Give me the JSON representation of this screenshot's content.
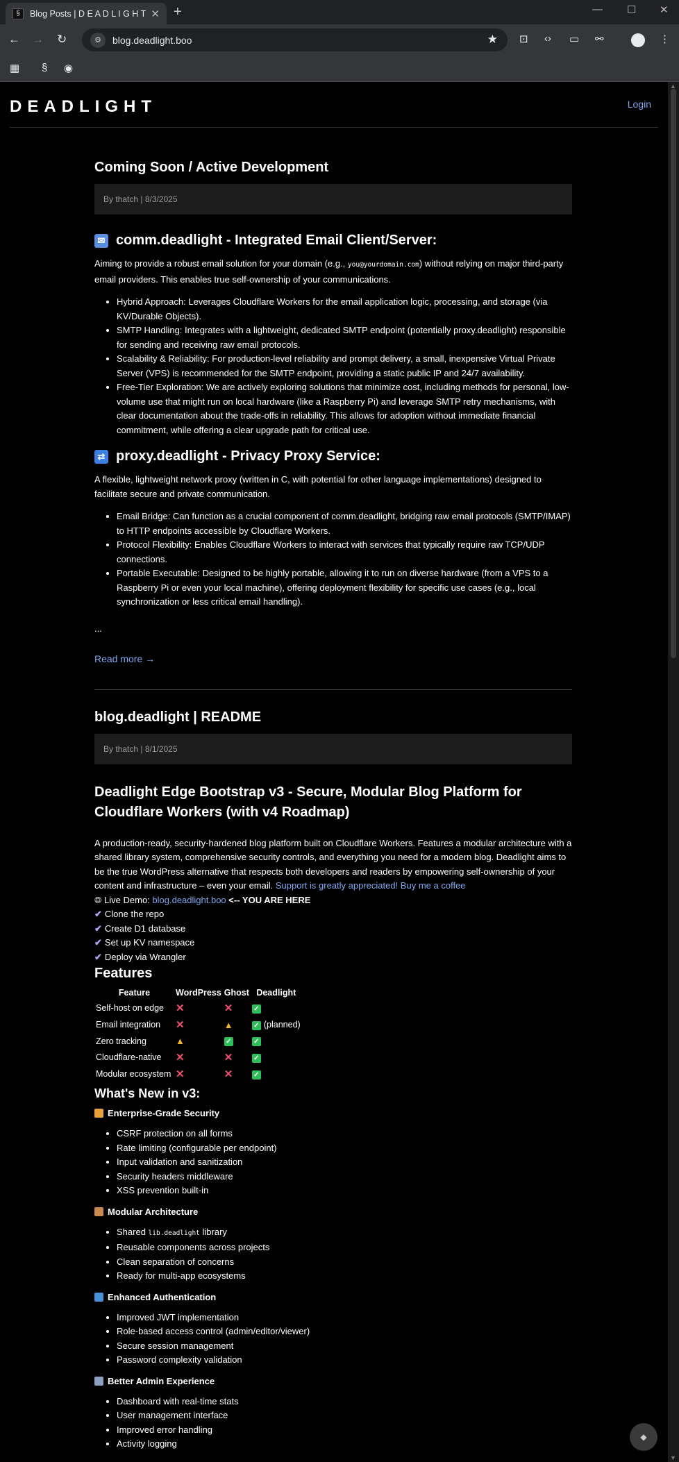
{
  "browser": {
    "tab_title": "Blog Posts | D E A D L I G H T",
    "url": "blog.deadlight.boo",
    "new_tab_label": "+",
    "close_label": "✕"
  },
  "site": {
    "logo": "DEADLIGHT",
    "login": "Login"
  },
  "post1": {
    "title": "Coming Soon / Active Development",
    "meta": "By thatch | 8/3/2025",
    "h1": "comm.deadlight - Integrated Email Client/Server:",
    "p1_a": "Aiming to provide a robust email solution for your domain (e.g., ",
    "p1_code": "you@yourdomain.com",
    "p1_b": ") without relying on major third-party email providers. This enables true self-ownership of your communications.",
    "list1": [
      "Hybrid Approach: Leverages Cloudflare Workers for the email application logic, processing, and storage (via KV/Durable Objects).",
      "SMTP Handling: Integrates with a lightweight, dedicated SMTP endpoint (potentially proxy.deadlight) responsible for sending and receiving raw email protocols.",
      "Scalability & Reliability: For production-level reliability and prompt delivery, a small, inexpensive Virtual Private Server (VPS) is recommended for the SMTP endpoint, providing a static public IP and 24/7 availability.",
      "Free-Tier Exploration: We are actively exploring solutions that minimize cost, including methods for personal, low-volume use that might run on local hardware (like a Raspberry Pi) and leverage SMTP retry mechanisms, with clear documentation about the trade-offs in reliability. This allows for adoption without immediate financial commitment, while offering a clear upgrade path for critical use."
    ],
    "h2": "proxy.deadlight - Privacy Proxy Service:",
    "p2": "A flexible, lightweight network proxy (written in C, with potential for other language implementations) designed to facilitate secure and private communication.",
    "list2": [
      "Email Bridge: Can function as a crucial component of comm.deadlight, bridging raw email protocols (SMTP/IMAP) to HTTP endpoints accessible by Cloudflare Workers.",
      "Protocol Flexibility: Enables Cloudflare Workers to interact with services that typically require raw TCP/UDP connections.",
      "Portable Executable: Designed to be highly portable, allowing it to run on diverse hardware (from a VPS to a Raspberry Pi or even your local machine), offering deployment flexibility for specific use cases (e.g., local synchronization or less critical email handling)."
    ],
    "ellipsis": "...",
    "read_more": "Read more →"
  },
  "post2": {
    "title": "blog.deadlight | README",
    "meta": "By thatch | 8/1/2025",
    "heading": "Deadlight Edge Bootstrap v3 - Secure, Modular Blog Platform for Cloudflare Workers (with v4 Roadmap)",
    "intro": "A production-ready, security-hardened blog platform built on Cloudflare Workers. Features a modular architecture with a shared library system, comprehensive security controls, and everything you need for a modern blog. Deadlight aims to be the true WordPress alternative that respects both developers and readers by empowering self-ownership of your content and infrastructure – even your email. ",
    "support_link": "Support is greatly appreciated! Buy me a coffee",
    "demo_label": "Live Demo: ",
    "demo_link": "blog.deadlight.boo",
    "demo_suffix": " <-- YOU ARE HERE",
    "checks": [
      "Clone the repo",
      "Create D1 database",
      "Set up KV namespace",
      "Deploy via Wrangler"
    ],
    "features_heading": "Features",
    "table_headers": [
      "Feature",
      "WordPress",
      "Ghost",
      "Deadlight"
    ],
    "table_rows": [
      {
        "feature": "Self-host on edge",
        "wp": "x",
        "ghost": "x",
        "dl": "ok",
        "note": ""
      },
      {
        "feature": "Email integration",
        "wp": "x",
        "ghost": "warn",
        "dl": "ok",
        "note": "(planned)"
      },
      {
        "feature": "Zero tracking",
        "wp": "warn",
        "ghost": "ok",
        "dl": "ok",
        "note": ""
      },
      {
        "feature": "Cloudflare-native",
        "wp": "x",
        "ghost": "x",
        "dl": "ok",
        "note": ""
      },
      {
        "feature": "Modular ecosystem",
        "wp": "x",
        "ghost": "x",
        "dl": "ok",
        "note": ""
      }
    ],
    "whats_new": "What's New in v3:",
    "sections": [
      {
        "title": "Enterprise-Grade Security",
        "color": "#e8a13a",
        "items": [
          "CSRF protection on all forms",
          "Rate limiting (configurable per endpoint)",
          "Input validation and sanitization",
          "Security headers middleware",
          "XSS prevention built-in"
        ]
      },
      {
        "title": "Modular Architecture",
        "color": "#c88a4e",
        "items_special": true,
        "items": [
          "Reusable components across projects",
          "Clean separation of concerns",
          "Ready for multi-app ecosystems"
        ],
        "first_a": "Shared ",
        "first_code": "lib.deadlight",
        "first_b": " library"
      },
      {
        "title": "Enhanced Authentication",
        "color": "#4a90d9",
        "items": [
          "Improved JWT implementation",
          "Role-based access control (admin/editor/viewer)",
          "Secure session management",
          "Password complexity validation"
        ]
      },
      {
        "title": "Better Admin Experience",
        "color": "#8ea0c0",
        "items": [
          "Dashboard with real-time stats",
          "User management interface",
          "Improved error handling",
          "Activity logging"
        ]
      }
    ]
  },
  "colors": {
    "link": "#7ea7ee",
    "background": "#000000",
    "meta_bg": "#1d1d1d"
  }
}
